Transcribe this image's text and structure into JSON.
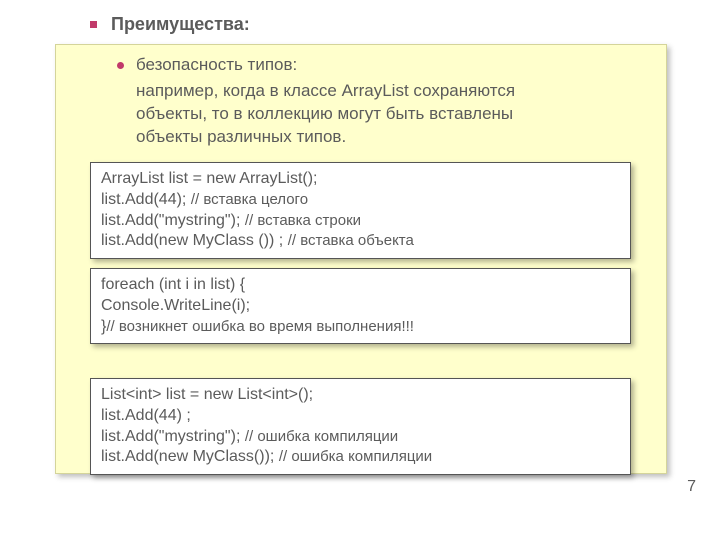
{
  "heading": "Преимущества:",
  "bullet": "безопасность типов:",
  "para_line1": "  например, когда в классе ArrayList сохраняются",
  "para_line2": "объекты, то в коллекцию могут быть вставлены",
  "para_line3": "объекты различных типов.",
  "code1": {
    "l1a": "ArrayList list = new ArrayList();",
    "l2a": "list.Add(44); ",
    "l2b": "// вставка целого",
    "l3a": "list.Add(\"mystring\"); ",
    "l3b": "// вставка строки",
    "l4a": "list.Add(new MyClass ()) ; ",
    "l4b": "// вставка объекта"
  },
  "code2": {
    "l1": "foreach (int i in list) {",
    "l2": "Console.WriteLine(i);",
    "l3a": "}",
    "l3b": "// возникнет ошибка во время выполнения!!!"
  },
  "code3": {
    "l1": "List<int> list = new List<int>();",
    "l2": "list.Add(44) ;",
    "l3a": "list.Add(\"mystring\");   ",
    "l3b": "// ошибка компиляции",
    "l4a": "list.Add(new MyClass());   ",
    "l4b": "// ошибка компиляции"
  },
  "page": "7"
}
